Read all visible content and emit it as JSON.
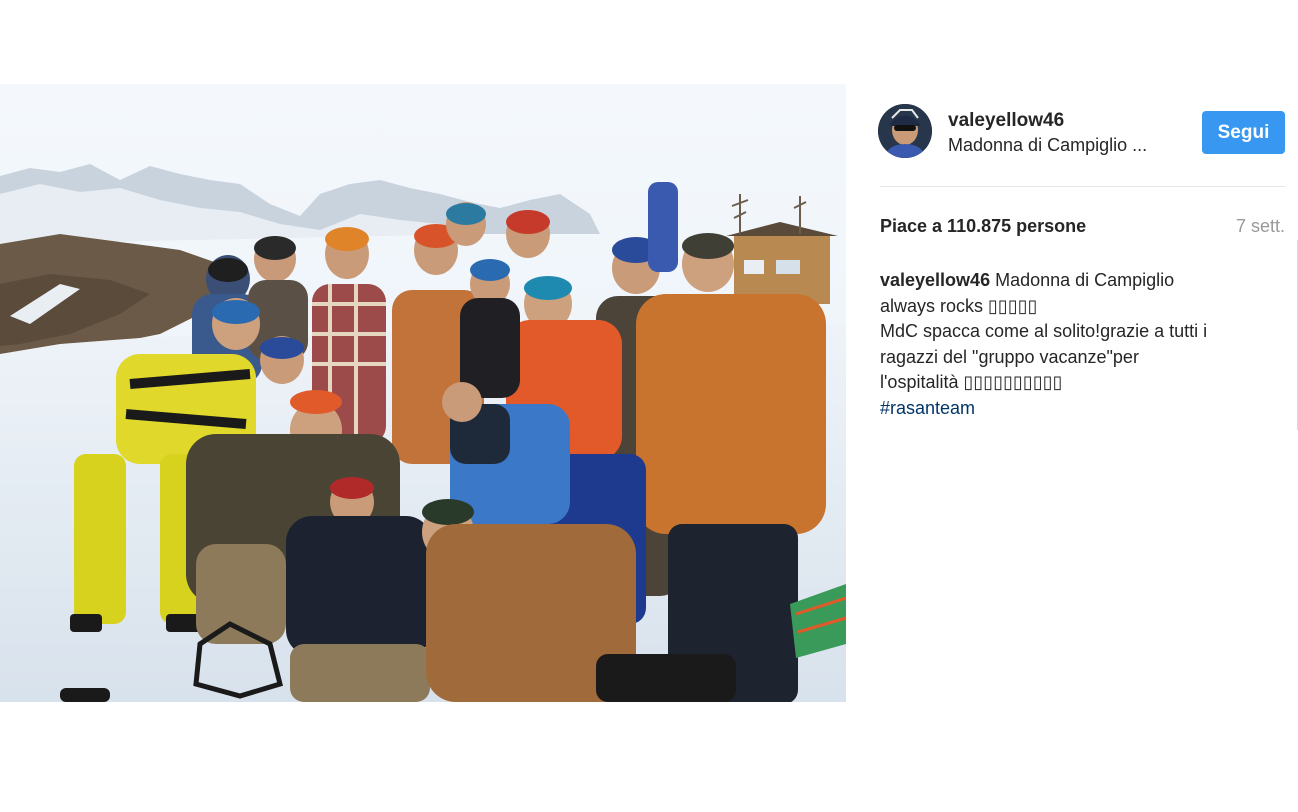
{
  "post": {
    "username": "valeyellow46",
    "location": "Madonna di Campiglio ...",
    "follow_label": "Segui",
    "likes": "Piace a 110.875 persone",
    "time": "7 sett.",
    "caption": {
      "user": "valeyellow46",
      "line1_text": " Madonna di Campiglio",
      "line2": "always rocks ▯▯▯▯▯",
      "line3": "MdC spacca come al solito!grazie a tutti i",
      "line4": "ragazzi del \"gruppo vacanze\"per",
      "line5": "l'ospitalità ▯▯▯▯▯▯▯▯▯▯",
      "hashtag": "#rasanteam"
    }
  },
  "colors": {
    "follow_button": "#3897f0",
    "hashtag": "#003569",
    "time": "#999999"
  },
  "icons": {
    "avatar": "profile-photo"
  }
}
